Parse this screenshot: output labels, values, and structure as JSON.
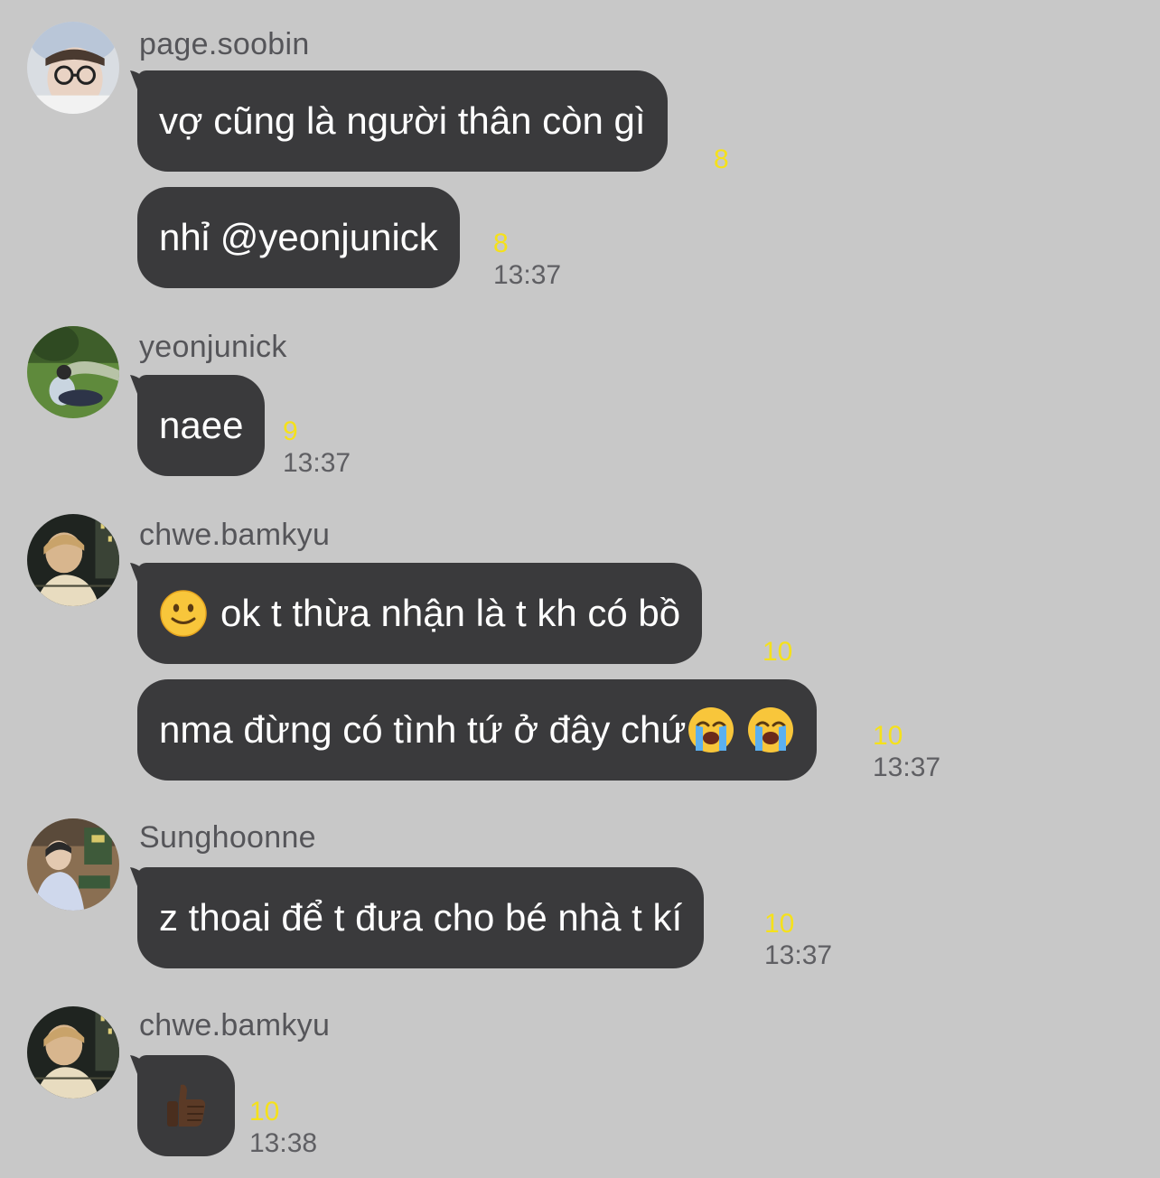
{
  "messages": [
    {
      "sender": "page.soobin",
      "avatar": "avatar-page-soobin",
      "bubbles": [
        {
          "text": "vợ cũng là người thân còn gì",
          "unread": "8"
        },
        {
          "text": "nhỉ @yeonjunick",
          "unread": "8",
          "time": "13:37"
        }
      ]
    },
    {
      "sender": "yeonjunick",
      "avatar": "avatar-yeonjunick",
      "bubbles": [
        {
          "text": "naee",
          "unread": "9",
          "time": "13:37"
        }
      ]
    },
    {
      "sender": "chwe.bamkyu",
      "avatar": "avatar-chwe-bamkyu",
      "bubbles": [
        {
          "emoji_before": "slightly-smiling-face",
          "text": "ok t thừa nhận là t kh có bồ",
          "unread": "10"
        },
        {
          "text": "nma đừng có tình tứ ở đây chứ",
          "emoji_after": [
            "loudly-crying-face",
            "loudly-crying-face"
          ],
          "unread": "10",
          "time": "13:37"
        }
      ]
    },
    {
      "sender": "Sunghoonne",
      "avatar": "avatar-sunghoonne",
      "bubbles": [
        {
          "text": "z thoai để t đưa cho bé nhà t kí",
          "unread": "10",
          "time": "13:37"
        }
      ]
    },
    {
      "sender": "chwe.bamkyu",
      "avatar": "avatar-chwe-bamkyu",
      "bubbles": [
        {
          "emoji_only": "thumbs-up-dark-skin",
          "unread": "10",
          "time": "13:38"
        }
      ]
    }
  ],
  "colors": {
    "background": "#c8c8c8",
    "bubble": "#3a3a3c",
    "bubble_text": "#ffffff",
    "unread_count": "#f5e11b",
    "timestamp": "#5f5f63",
    "sender_name": "#555559"
  }
}
